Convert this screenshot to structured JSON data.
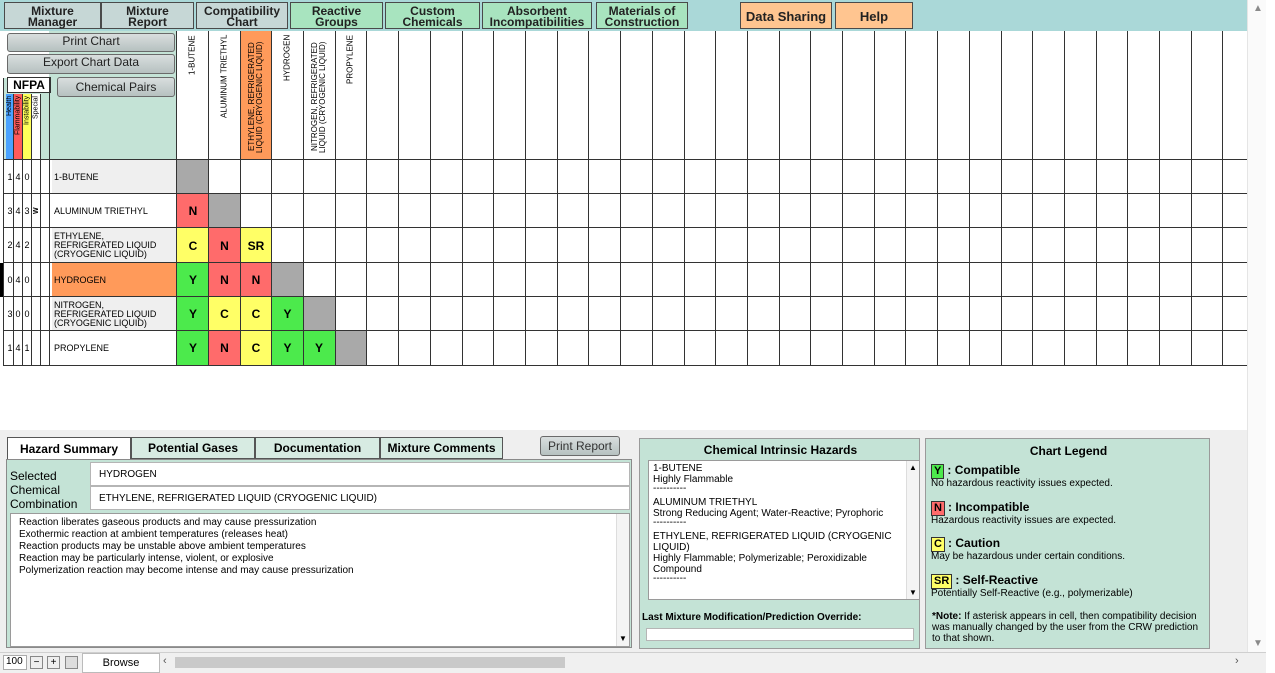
{
  "top_tabs": [
    {
      "label": "Mixture\nManager"
    },
    {
      "label": "Mixture\nReport"
    },
    {
      "label": "Compatibility\nChart"
    },
    {
      "label": "Reactive\nGroups"
    },
    {
      "label": "Custom\nChemicals"
    },
    {
      "label": "Absorbent\nIncompatibilities"
    },
    {
      "label": "Materials of\nConstruction"
    },
    {
      "label": "Data Sharing"
    },
    {
      "label": "Help"
    }
  ],
  "toolbar": {
    "print_chart": "Print Chart",
    "export_chart_data": "Export Chart Data",
    "nfpa": "NFPA",
    "chemical_pairs": "Chemical Pairs",
    "nfpa_headers": [
      "Health",
      "Flammability",
      "Instability",
      "Special"
    ]
  },
  "chemicals": [
    {
      "name": "1-BUTENE",
      "nfpa": [
        "1",
        "4",
        "0"
      ],
      "special": "",
      "column": "1-BUTENE"
    },
    {
      "name": "ALUMINUM TRIETHYL",
      "nfpa": [
        "3",
        "4",
        "3"
      ],
      "special": "W",
      "column": "ALUMINUM TRIETHYL"
    },
    {
      "name": "ETHYLENE, REFRIGERATED LIQUID (CRYOGENIC LIQUID)",
      "nfpa": [
        "2",
        "4",
        "2"
      ],
      "special": "",
      "column": "ETHYLENE, REFRIGERATED LIQUID (CRYOGENIC LIQUID)"
    },
    {
      "name": "HYDROGEN",
      "nfpa": [
        "0",
        "4",
        "0"
      ],
      "special": "",
      "column": "HYDROGEN"
    },
    {
      "name": "NITROGEN, REFRIGERATED LIQUID (CRYOGENIC LIQUID)",
      "nfpa": [
        "3",
        "0",
        "0"
      ],
      "special": "",
      "column": "NITROGEN, REFRIGERATED LIQUID (CRYOGENIC LIQUID)"
    },
    {
      "name": "PROPYLENE",
      "nfpa": [
        "1",
        "4",
        "1"
      ],
      "special": "",
      "column": "PROPYLENE"
    }
  ],
  "matrix": [
    [
      "X"
    ],
    [
      "N",
      "X"
    ],
    [
      "C",
      "N",
      "SR"
    ],
    [
      "Y",
      "N",
      "N",
      "X"
    ],
    [
      "Y",
      "C",
      "C",
      "Y",
      "X"
    ],
    [
      "Y",
      "N",
      "C",
      "Y",
      "Y",
      "X"
    ]
  ],
  "bottom_tabs": [
    "Hazard Summary",
    "Potential Gases",
    "Documentation",
    "Mixture Comments"
  ],
  "print_report": "Print Report",
  "hazard_summary": {
    "selected_label": "Selected\nChemical\nCombination",
    "chemical_a": "HYDROGEN",
    "chemical_b": "ETHYLENE, REFRIGERATED LIQUID (CRYOGENIC LIQUID)",
    "reactions": [
      "Reaction liberates gaseous products and may cause pressurization",
      "Exothermic reaction at ambient temperatures (releases heat)",
      "Reaction products may be unstable above ambient temperatures",
      "Reaction may be particularly intense, violent, or explosive",
      "Polymerization reaction may become intense and may cause pressurization"
    ]
  },
  "intrinsic": {
    "title": "Chemical Intrinsic Hazards",
    "entries": [
      {
        "name": "1-BUTENE",
        "hazards": "Highly Flammable"
      },
      {
        "name": "ALUMINUM TRIETHYL",
        "hazards": "Strong Reducing Agent; Water-Reactive; Pyrophoric"
      },
      {
        "name": "ETHYLENE, REFRIGERATED LIQUID (CRYOGENIC LIQUID)",
        "hazards": "Highly Flammable; Polymerizable; Peroxidizable Compound"
      }
    ],
    "separator": "----------",
    "override_label": "Last Mixture Modification/Prediction Override:",
    "override_value": ""
  },
  "legend": {
    "title": "Chart Legend",
    "items": [
      {
        "code": "Y",
        "label": "Compatible",
        "desc": "No hazardous reactivity issues expected.",
        "color": "#4cea4c"
      },
      {
        "code": "N",
        "label": "Incompatible",
        "desc": "Hazardous reactivity issues are expected.",
        "color": "#ff6b6b"
      },
      {
        "code": "C",
        "label": "Caution",
        "desc": "May be hazardous under certain conditions.",
        "color": "#ffff66"
      },
      {
        "code": "SR",
        "label": "Self-Reactive",
        "desc": "Potentially Self-Reactive (e.g., polymerizable)",
        "color": "#ffff66"
      }
    ],
    "note_title": "*Note:",
    "note": "If asterisk appears in cell, then compatibility decision was manually changed by the user from the CRW prediction to that shown."
  },
  "status": {
    "zoom": "100",
    "sheet": "Browse"
  }
}
